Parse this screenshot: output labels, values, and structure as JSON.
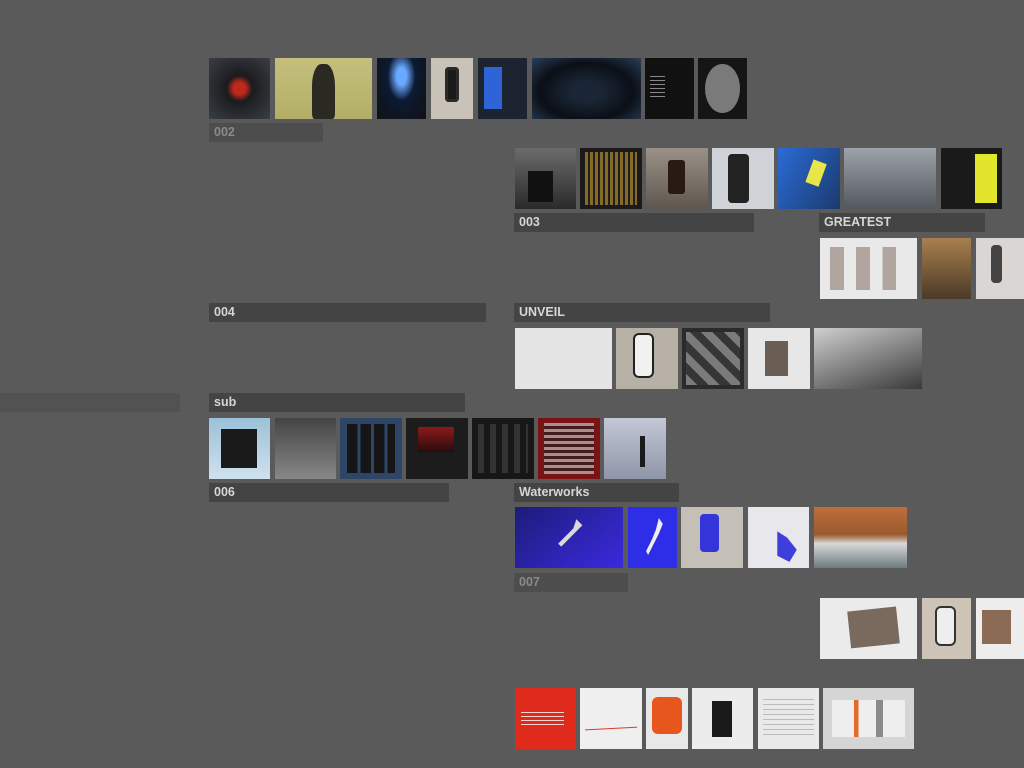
{
  "colors": {
    "background": "#5a5a5a",
    "label_bg": "#444444",
    "label_text": "#d6d6d6"
  },
  "labels": {
    "l002": "002",
    "l_ghost_top": "",
    "l003": "003",
    "greatest": "GREATEST",
    "l004": "004",
    "unveil": "UNVEIL",
    "sub": "sub",
    "l006": "006",
    "waterworks": "Waterworks",
    "l007": "007"
  }
}
